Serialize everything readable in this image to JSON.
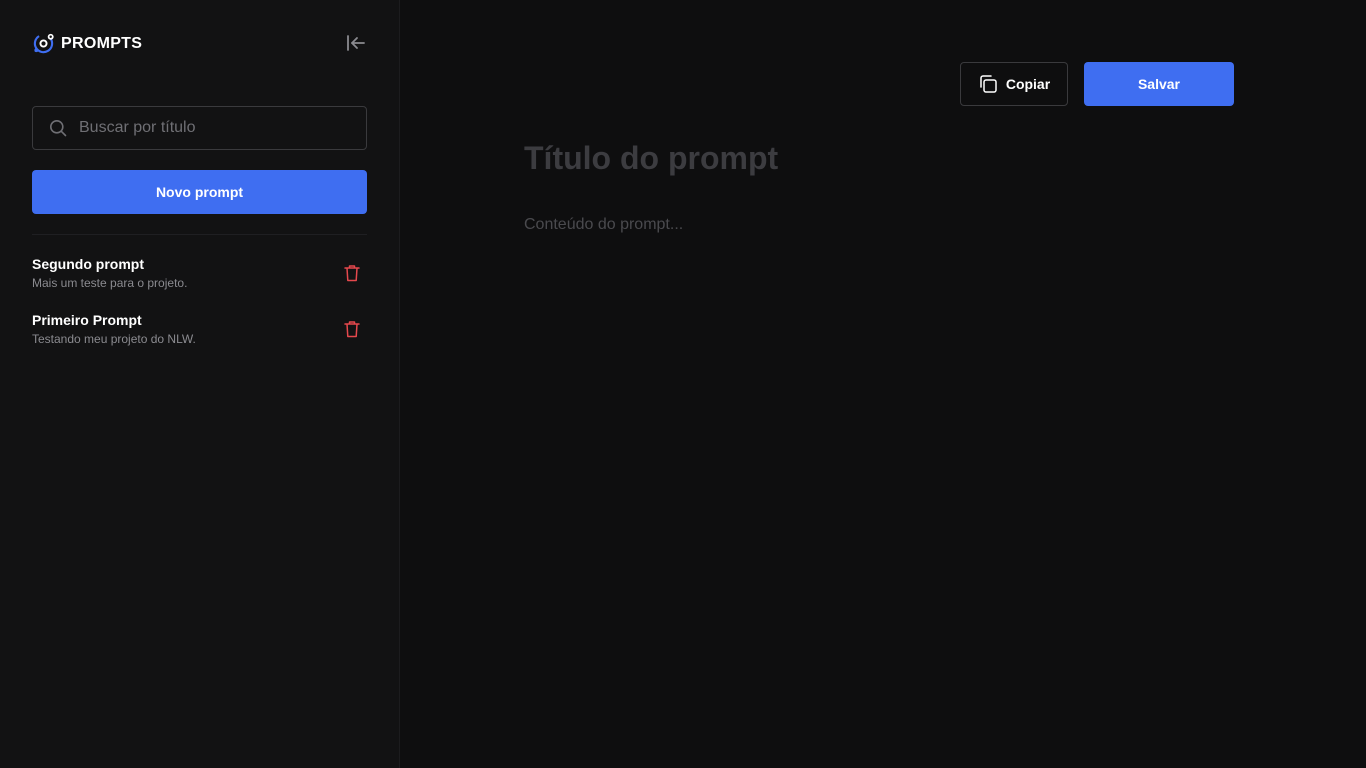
{
  "brand": {
    "name": "PROMPTS",
    "logo_icon": "orbit-logo-icon",
    "accent": "#3f6ef1"
  },
  "sidebar": {
    "collapse_icon": "collapse-left-icon",
    "search": {
      "placeholder": "Buscar por título",
      "value": "",
      "icon": "search-icon"
    },
    "new_button_label": "Novo prompt",
    "prompts": [
      {
        "title": "Segundo prompt",
        "description": "Mais um teste para o projeto."
      },
      {
        "title": "Primeiro Prompt",
        "description": "Testando meu projeto do NLW."
      }
    ],
    "delete_icon": "trash-icon",
    "delete_color": "#e5484d"
  },
  "editor": {
    "copy_button_label": "Copiar",
    "copy_icon": "copy-icon",
    "save_button_label": "Salvar",
    "title_placeholder": "Título do prompt",
    "content_placeholder": "Conteúdo do prompt..."
  }
}
